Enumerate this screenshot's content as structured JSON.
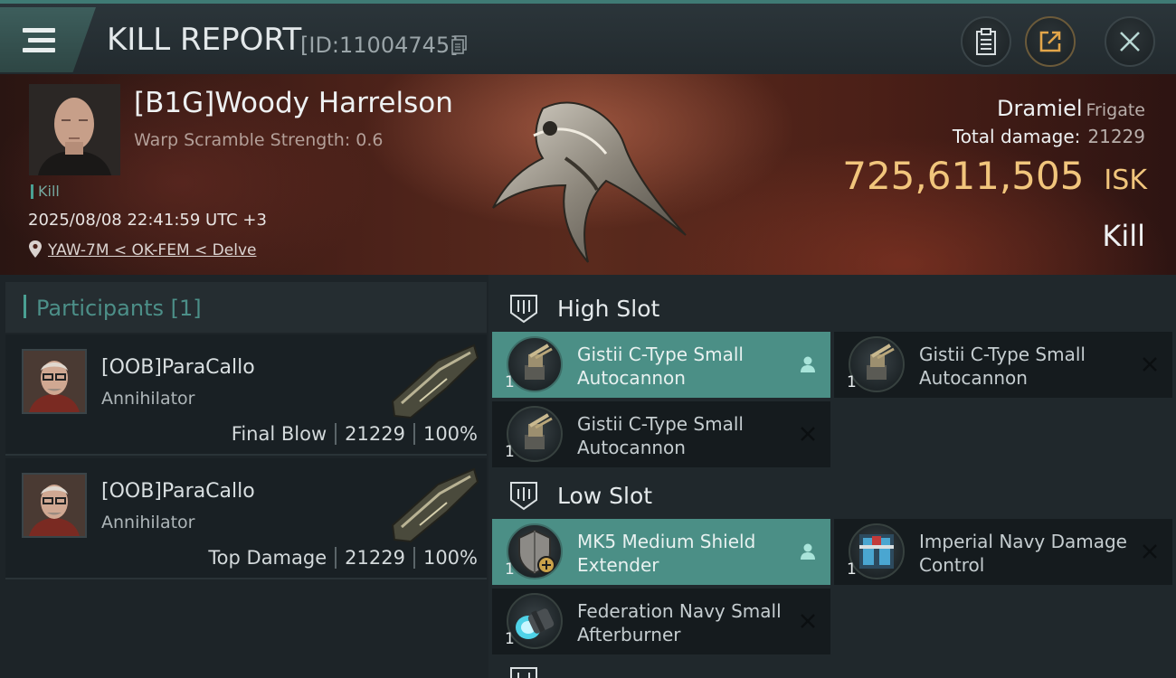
{
  "header": {
    "title": "KILL REPORT",
    "id_label": "[ID:11004745]"
  },
  "victim": {
    "name": "[B1G]Woody Harrelson",
    "subtitle": "Warp Scramble Strength: 0.6",
    "tag": "Kill",
    "time": "2025/08/08 22:41:59 UTC +3",
    "location": "YAW-7M < OK-FEM < Delve",
    "ship_name": "Dramiel",
    "ship_class": "Frigate",
    "total_damage_label": "Total damage:",
    "total_damage": "21229",
    "isk_value": "725,611,505",
    "isk_unit": "ISK",
    "status": "Kill"
  },
  "participants": {
    "title": "Participants [1]",
    "items": [
      {
        "name": "[OOB]ParaCallo",
        "ship": "Annihilator",
        "role": "Final Blow",
        "damage": "21229",
        "percent": "100%"
      },
      {
        "name": "[OOB]ParaCallo",
        "ship": "Annihilator",
        "role": "Top Damage",
        "damage": "21229",
        "percent": "100%"
      }
    ]
  },
  "fitting": {
    "high_slot": {
      "title": "High Slot",
      "modules": [
        {
          "name": "Gistii C-Type Small Autocannon",
          "qty": "1",
          "status": "dropped",
          "icon": "autocannon-icon"
        },
        {
          "name": "Gistii C-Type Small Autocannon",
          "qty": "1",
          "status": "destroyed",
          "icon": "autocannon-icon"
        },
        {
          "name": "Gistii C-Type Small Autocannon",
          "qty": "1",
          "status": "destroyed",
          "icon": "autocannon-icon"
        }
      ]
    },
    "low_slot": {
      "title": "Low Slot",
      "modules": [
        {
          "name": "MK5 Medium Shield Extender",
          "qty": "1",
          "status": "dropped",
          "icon": "shield-extender-icon"
        },
        {
          "name": "Imperial Navy Damage Control",
          "qty": "1",
          "status": "destroyed",
          "icon": "damage-control-icon"
        },
        {
          "name": "Federation Navy Small Afterburner",
          "qty": "1",
          "status": "destroyed",
          "icon": "afterburner-icon"
        }
      ]
    }
  },
  "colors": {
    "accent_teal": "#4b8f86",
    "isk_gold": "#f1c57c",
    "banner_red": "#5a2a1d"
  }
}
